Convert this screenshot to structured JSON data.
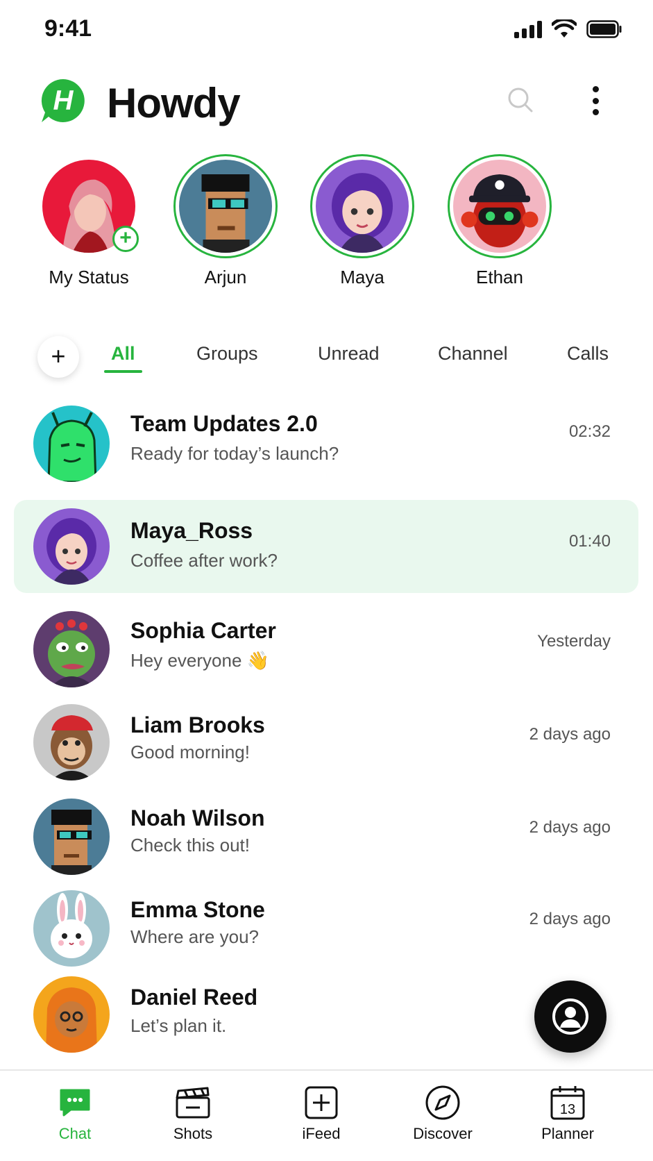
{
  "status_bar": {
    "time": "9:41"
  },
  "header": {
    "app_name": "Howdy",
    "logo_letter": "H"
  },
  "stories": [
    {
      "name": "My Status",
      "avatar": "anime-pink-hair",
      "bg": "#e8193a",
      "has_add": true
    },
    {
      "name": "Arjun",
      "avatar": "pixel-punk-glasses",
      "bg": "#4c7c96",
      "has_add": false
    },
    {
      "name": "Maya",
      "avatar": "cartoon-purple-hair-girl",
      "bg": "#8a5bd0",
      "has_add": false
    },
    {
      "name": "Ethan",
      "avatar": "red-robot-cap",
      "bg": "#f3b6c2",
      "has_add": false
    }
  ],
  "filters": {
    "add_label": "+",
    "tabs": [
      "All",
      "Groups",
      "Unread",
      "Channel",
      "Calls"
    ],
    "active": "All"
  },
  "chats": [
    {
      "name": "Team Updates 2.0",
      "preview": "Ready for today’s launch?",
      "time": "02:32",
      "avatar": "green-alien",
      "bg": "#25c2c9",
      "selected": false
    },
    {
      "name": "Maya_Ross",
      "preview": "Coffee after work?",
      "time": "01:40",
      "avatar": "cartoon-purple-hair-girl",
      "bg": "#8a5bd0",
      "selected": true
    },
    {
      "name": "Sophia Carter",
      "preview": "Hey everyone 👋",
      "time": "Yesterday",
      "avatar": "frog-flower-crown",
      "bg": "#5e3d6e",
      "selected": false
    },
    {
      "name": "Liam Brooks",
      "preview": "Good morning!",
      "time": "2 days ago",
      "avatar": "monkey-bandana",
      "bg": "#c8c8c8",
      "selected": false
    },
    {
      "name": "Noah Wilson",
      "preview": "Check this out!",
      "time": "2 days ago",
      "avatar": "pixel-punk-glasses",
      "bg": "#4c7c96",
      "selected": false
    },
    {
      "name": "Emma Stone",
      "preview": "Where are you?",
      "time": "2 days ago",
      "avatar": "white-bunny",
      "bg": "#9fc3cc",
      "selected": false
    },
    {
      "name": "Daniel Reed",
      "preview": "Let’s plan it.",
      "time": "",
      "avatar": "tiger-hoodie",
      "bg": "#f4a51c",
      "selected": false
    }
  ],
  "fab": {
    "icon": "contact-icon"
  },
  "bottom_nav": [
    {
      "label": "Chat",
      "icon": "chat-bubble-icon",
      "active": true
    },
    {
      "label": "Shots",
      "icon": "clapperboard-icon",
      "active": false
    },
    {
      "label": "iFeed",
      "icon": "plus-square-icon",
      "active": false
    },
    {
      "label": "Discover",
      "icon": "compass-icon",
      "active": false
    },
    {
      "label": "Planner",
      "icon": "calendar-icon",
      "active": false,
      "badge": "13"
    }
  ],
  "colors": {
    "accent": "#27b43e",
    "selected_row": "#e9f8ee",
    "text": "#111111",
    "muted": "#555555"
  }
}
